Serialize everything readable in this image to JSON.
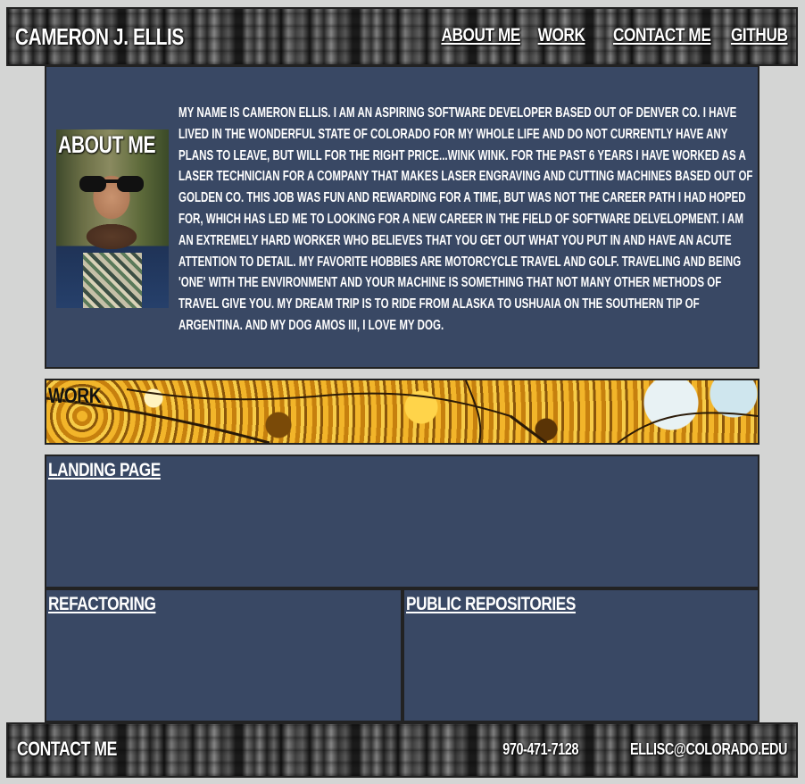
{
  "header": {
    "name": "Cameron J. Ellis",
    "nav": [
      {
        "label": "About Me"
      },
      {
        "label": "Work"
      },
      {
        "label": "Contact Me"
      },
      {
        "label": "GitHub"
      }
    ]
  },
  "about": {
    "title": "About Me",
    "photo_icon": "profile-photo",
    "bio_lines": [
      "My name is Cameron Ellis. I am an aspiring software developer based out of Denver CO. I have",
      "lived in the wonderful state of Colorado for my whole life and do not currently have any",
      "plans to leave, but will for the right price...wink wink. For the past 6 years I have worked as a",
      "laser technician for a company that makes laser engraving and cutting machines based out of",
      "Golden CO. This job was fun and rewarding for a time, but was not the career path I had hoped",
      "for, which has led me to looking for a new career in the field of software delvelopment. I am",
      "an extremely hard worker who believes that you get out what you put in and have an acute",
      "attention to detail. My favorite hobbies are motorcycle travel and golf. Traveling and being",
      "'one' with the environment and your machine is something that not many other methods of",
      "travel give you. My dream trip is to ride from Alaska to Ushuaia on the southern tip of",
      "Argentina. And my dog Amos III, I love my dog."
    ]
  },
  "work": {
    "title": "Work",
    "projects": [
      {
        "label": "Landing Page"
      },
      {
        "label": "Refactoring"
      },
      {
        "label": "Public Repositories"
      }
    ]
  },
  "footer": {
    "label": "Contact Me",
    "phone": "970-471-7128",
    "email": "ellisc@colorado.edu"
  },
  "colors": {
    "page_bg": "#d4d5d4",
    "panel_bg": "#394864",
    "border": "#222222",
    "text": "#ffffff"
  }
}
